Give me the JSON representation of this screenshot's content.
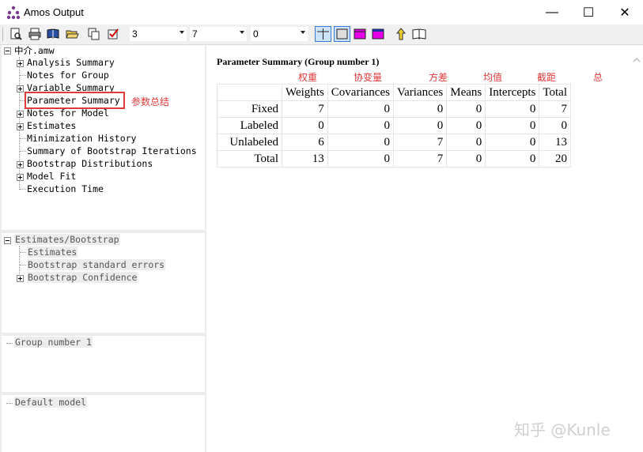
{
  "window": {
    "title": "Amos Output",
    "minimize_glyph": "—",
    "maximize_glyph": "☐",
    "close_glyph": "✕"
  },
  "toolbar": {
    "combo1_value": "3",
    "combo2_value": "7",
    "combo3_value": "0",
    "icons": [
      "print-preview-icon",
      "print-icon",
      "book-icon",
      "open-folder-icon",
      "copy-icon",
      "checkbox-icon",
      "table-grid-icon",
      "table-outline-icon",
      "magenta-table-icon",
      "magenta-table-bar-icon",
      "up-arrow-icon",
      "open-book-icon"
    ]
  },
  "tree": {
    "root": "中介.amw",
    "items": [
      {
        "label": "Analysis Summary",
        "expandable": true
      },
      {
        "label": "Notes for Group",
        "expandable": false
      },
      {
        "label": "Variable Summary",
        "expandable": true
      },
      {
        "label": "Parameter Summary",
        "expandable": false
      },
      {
        "label": "Notes for Model",
        "expandable": true
      },
      {
        "label": "Estimates",
        "expandable": true
      },
      {
        "label": "Minimization History",
        "expandable": false
      },
      {
        "label": "Summary of Bootstrap Iterations",
        "expandable": false
      },
      {
        "label": "Bootstrap Distributions",
        "expandable": true
      },
      {
        "label": "Model Fit",
        "expandable": true
      },
      {
        "label": "Execution Time",
        "expandable": false
      }
    ]
  },
  "annotation_param_summary": "参数总结",
  "estimates_panel": {
    "root": "Estimates/Bootstrap",
    "items": [
      "Estimates",
      "Bootstrap standard errors",
      "Bootstrap Confidence"
    ]
  },
  "group_panel": {
    "label": "Group number 1"
  },
  "model_panel": {
    "label": "Default model"
  },
  "parameter_summary": {
    "title": "Parameter Summary (Group number 1)",
    "chinese_headers": [
      "权重",
      "协变量",
      "方差",
      "均值",
      "截距",
      "总"
    ],
    "columns": [
      "Weights",
      "Covariances",
      "Variances",
      "Means",
      "Intercepts",
      "Total"
    ],
    "rows": [
      {
        "label": "Fixed",
        "values": [
          "7",
          "0",
          "0",
          "0",
          "0",
          "7"
        ]
      },
      {
        "label": "Labeled",
        "values": [
          "0",
          "0",
          "0",
          "0",
          "0",
          "0"
        ]
      },
      {
        "label": "Unlabeled",
        "values": [
          "6",
          "0",
          "7",
          "0",
          "0",
          "13"
        ]
      },
      {
        "label": "Total",
        "values": [
          "13",
          "0",
          "7",
          "0",
          "0",
          "20"
        ]
      }
    ]
  },
  "watermark": "知乎 @Kunle",
  "colors": {
    "annotation": "#e03a3a",
    "panel_bg": "#ececec",
    "toolbar_bg": "#f0f0f0"
  }
}
